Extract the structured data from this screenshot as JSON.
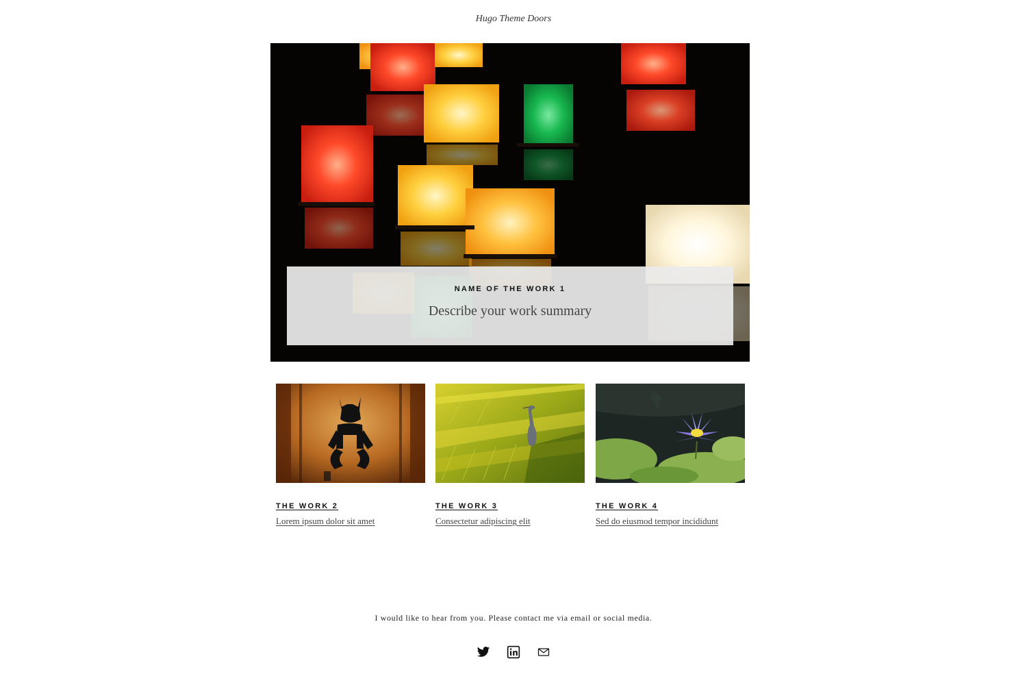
{
  "site": {
    "title": "Hugo Theme Doors"
  },
  "hero": {
    "title": "NAME OF THE WORK 1",
    "summary": "Describe your work summary",
    "image": "floating-lanterns"
  },
  "works": [
    {
      "title": "THE WORK 2",
      "summary": "Lorem ipsum dolor sit amet",
      "image": "demon-lantern"
    },
    {
      "title": "THE WORK 3",
      "summary": "Consectetur adipiscing elit",
      "image": "heron-in-rice-field"
    },
    {
      "title": "THE WORK 4",
      "summary": "Sed do eiusmod tempor incididunt",
      "image": "water-lily"
    }
  ],
  "footer": {
    "contact_text": "I would like to hear from you. Please contact me via email or social media.",
    "social": [
      {
        "icon": "twitter-icon"
      },
      {
        "icon": "linkedin-icon"
      },
      {
        "icon": "mail-icon"
      }
    ]
  }
}
